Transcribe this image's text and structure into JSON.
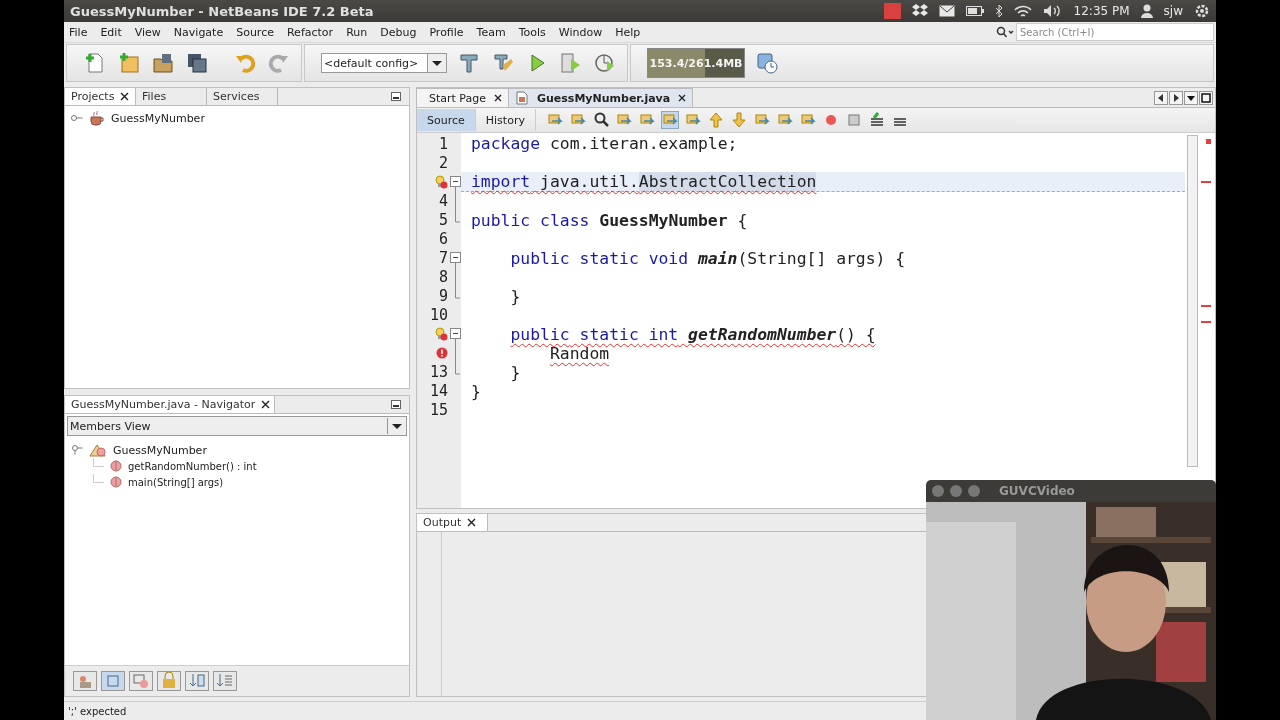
{
  "window": {
    "title": "GuessMyNumber - NetBeans IDE 7.2 Beta"
  },
  "system_tray": {
    "time": "12:35 PM",
    "user": "sjw"
  },
  "menu": [
    "File",
    "Edit",
    "View",
    "Navigate",
    "Source",
    "Refactor",
    "Run",
    "Debug",
    "Profile",
    "Team",
    "Tools",
    "Window",
    "Help"
  ],
  "search": {
    "placeholder": "Search (Ctrl+I)"
  },
  "toolbar": {
    "config": "<default config>",
    "memory": {
      "reading": "153.4/261.4MB",
      "level": 0.59
    }
  },
  "projects_panel": {
    "tabs": [
      {
        "label": "Projects",
        "selected": true,
        "closable": true
      },
      {
        "label": "Files",
        "selected": false,
        "closable": false
      },
      {
        "label": "Services",
        "selected": false,
        "closable": false
      }
    ],
    "tree": [
      {
        "label": "GuessMyNumber",
        "expanded": false
      }
    ]
  },
  "navigator": {
    "title": "GuessMyNumber.java - Navigator",
    "view": "Members View",
    "tree": [
      {
        "label": "GuessMyNumber",
        "expanded": true,
        "children": [
          {
            "label": "getRandomNumber() : int"
          },
          {
            "label": "main(String[] args)"
          }
        ]
      }
    ]
  },
  "editor": {
    "tabs": [
      {
        "label": "Start Page",
        "selected": false
      },
      {
        "label": "GuessMyNumber.java",
        "selected": true
      }
    ],
    "views": [
      {
        "label": "Source",
        "selected": true
      },
      {
        "label": "History",
        "selected": false
      }
    ],
    "lines": [
      {
        "kind": "numbered",
        "number": "1",
        "tokens": [
          {
            "text": "package",
            "kind": "keyword"
          },
          {
            "text": " com.iteran.example;",
            "kind": "plain"
          }
        ]
      },
      {
        "kind": "numbered",
        "number": "2"
      },
      {
        "kind": "hint-error",
        "fold": {
          "kind": "start"
        },
        "current": true,
        "error": true,
        "tokens": [
          {
            "text": "import",
            "kind": "keyword"
          },
          {
            "text": " java.util.",
            "kind": "plain"
          },
          {
            "text": "AbstractCollection",
            "kind": "plain",
            "highlight": true
          }
        ]
      },
      {
        "kind": "numbered",
        "number": "4",
        "fold": {
          "kind": "mid"
        }
      },
      {
        "kind": "numbered",
        "number": "5",
        "fold": {
          "kind": "end"
        },
        "tokens": [
          {
            "text": "public",
            "kind": "keyword"
          },
          {
            "text": " class",
            "kind": "keyword"
          },
          {
            "text": " GuessMyNumber",
            "kind": "class"
          },
          {
            "text": " {",
            "kind": "plain"
          }
        ],
        "children": [
          {
            "kind": "numbered",
            "number": "6"
          },
          {
            "kind": "numbered",
            "number": "7",
            "fold": {
              "kind": "start"
            },
            "tokens": [
              {
                "text": "public",
                "kind": "keyword"
              },
              {
                "text": " static",
                "kind": "keyword"
              },
              {
                "text": " void",
                "kind": "keyword"
              },
              {
                "text": " main",
                "kind": "method"
              },
              {
                "text": "(String[] args) {",
                "kind": "plain"
              }
            ],
            "children": [
              {
                "kind": "numbered",
                "number": "8",
                "fold": {
                  "kind": "mid"
                }
              }
            ]
          },
          {
            "kind": "numbered",
            "number": "9",
            "fold": {
              "kind": "end"
            },
            "tokens": [
              {
                "text": "}",
                "kind": "plain"
              }
            ]
          },
          {
            "kind": "numbered",
            "number": "10"
          },
          {
            "kind": "hint-error",
            "fold": {
              "kind": "start"
            },
            "error": true,
            "tokens": [
              {
                "text": "public",
                "kind": "keyword"
              },
              {
                "text": " static",
                "kind": "keyword"
              },
              {
                "text": " int",
                "kind": "keyword"
              },
              {
                "text": " getRandomNumber",
                "kind": "method"
              },
              {
                "text": "() {",
                "kind": "plain"
              }
            ],
            "children": [
              {
                "kind": "error",
                "fold": {
                  "kind": "mid"
                },
                "error": true,
                "tokens": [
                  {
                    "text": "Random",
                    "kind": "plain"
                  }
                ]
              }
            ]
          },
          {
            "kind": "numbered",
            "number": "13",
            "fold": {
              "kind": "end"
            },
            "tokens": [
              {
                "text": "}",
                "kind": "plain"
              }
            ]
          }
        ]
      },
      {
        "kind": "numbered",
        "number": "14",
        "tokens": [
          {
            "text": "}",
            "kind": "plain"
          }
        ]
      },
      {
        "kind": "numbered",
        "number": "15"
      }
    ]
  },
  "output": {
    "tab": "Output"
  },
  "status_bar": "';' expected",
  "video_window": {
    "title": "GUVCVideo"
  }
}
